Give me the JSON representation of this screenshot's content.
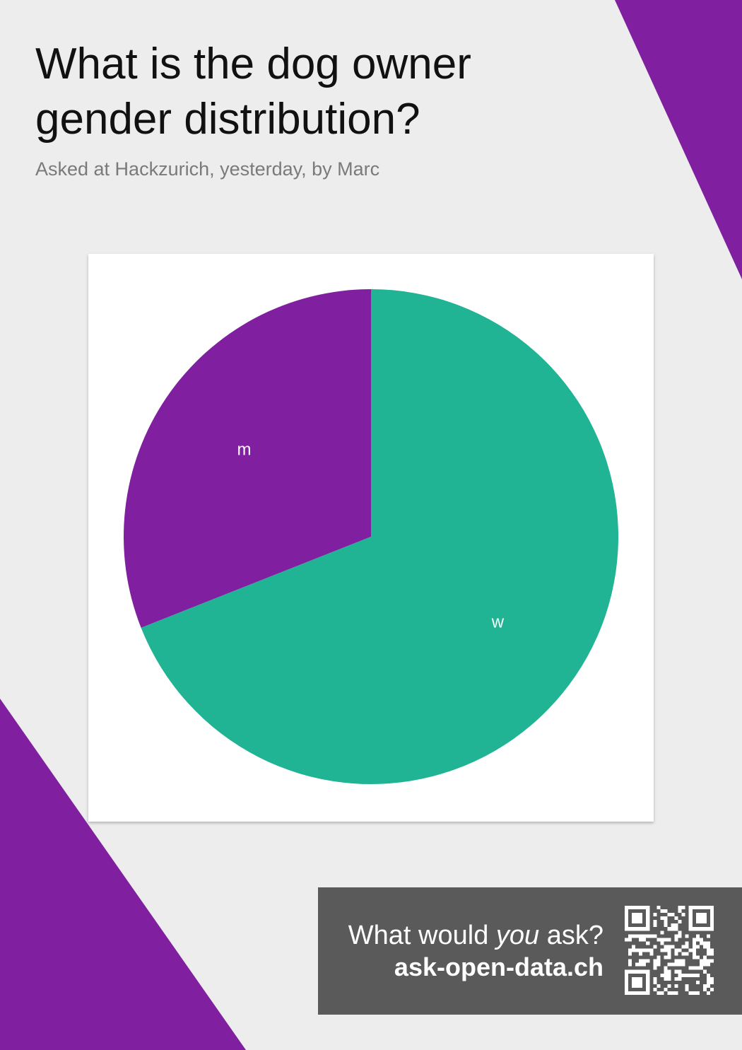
{
  "header": {
    "title": "What is the dog owner gender distribution?",
    "subtitle": "Asked at Hackzurich, yesterday, by Marc"
  },
  "footer": {
    "prompt_before": "What would ",
    "prompt_emphasis": "you",
    "prompt_after": " ask?",
    "site": "ask-open-data.ch"
  },
  "colors": {
    "accent": "#8020a0",
    "w": "#20b494",
    "m": "#8020a0",
    "background": "#ededed",
    "footer": "#5a5a5b"
  },
  "chart_data": {
    "type": "pie",
    "title": "",
    "slices": [
      {
        "label": "w",
        "value": 69
      },
      {
        "label": "m",
        "value": 31
      }
    ]
  }
}
